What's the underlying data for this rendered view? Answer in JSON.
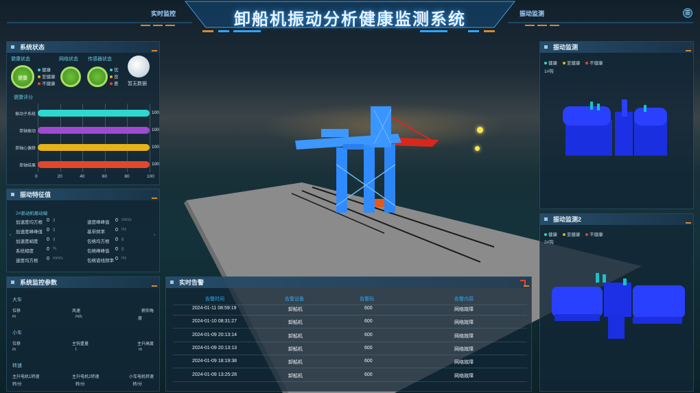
{
  "header": {
    "title": "卸船机振动分析健康监测系统",
    "nav_left": "实时监控",
    "nav_right": "振动监测",
    "menu_icon": "menu-icon"
  },
  "system_status": {
    "title": "系统状态",
    "health": {
      "label": "健康状态",
      "value": "健康",
      "legend": [
        "健康",
        "亚健康",
        "不健康"
      ]
    },
    "network": {
      "label": "网络状态",
      "legend": [
        "优",
        "良",
        "差"
      ]
    },
    "sensor": {
      "label": "传感器状态"
    },
    "no_data": "暂无数据",
    "score_label": "健康评分",
    "bars": [
      {
        "name": "振动子系统",
        "value": 100,
        "color": "#2ed8cf"
      },
      {
        "name": "单轴振动",
        "value": 100,
        "color": "#a04ad0"
      },
      {
        "name": "单轴心偏移",
        "value": 100,
        "color": "#e6b418"
      },
      {
        "name": "单轴结果",
        "value": 100,
        "color": "#e2472d"
      }
    ],
    "ticks": [
      "0",
      "20",
      "40",
      "60",
      "80",
      "100"
    ]
  },
  "vib_features": {
    "title": "振动特征值",
    "subtitle": "2#驱动机振动端",
    "left": [
      {
        "label": "加速度均方根",
        "value": "0",
        "unit": "g"
      },
      {
        "label": "加速度峰峰值",
        "value": "0",
        "unit": "g"
      },
      {
        "label": "加速度峭度",
        "value": "0",
        "unit": "g"
      },
      {
        "label": "系统相度",
        "value": "0",
        "unit": "%"
      },
      {
        "label": "速度均方根",
        "value": "0",
        "unit": "mm/s"
      }
    ],
    "right": [
      {
        "label": "速度峰峰值",
        "value": "0",
        "unit": "mm/s"
      },
      {
        "label": "基带频率",
        "value": "0",
        "unit": "Hz"
      },
      {
        "label": "包络均方根",
        "value": "0",
        "unit": "g"
      },
      {
        "label": "包络峰峰值",
        "value": "0",
        "unit": "g"
      },
      {
        "label": "包络谱线频率",
        "value": "0",
        "unit": "Hz"
      }
    ]
  },
  "sys_params": {
    "title": "系统监控参数",
    "sections": [
      {
        "name": "大车",
        "items": [
          {
            "label": "位移",
            "unit": "m"
          },
          {
            "label": "风速",
            "unit": "m/s"
          },
          {
            "label": "俯仰角",
            "unit": "度"
          }
        ]
      },
      {
        "name": "小车",
        "items": [
          {
            "label": "位移",
            "unit": "m"
          },
          {
            "label": "主钩重量",
            "unit": "t"
          },
          {
            "label": "主升高度",
            "unit": "m"
          }
        ]
      },
      {
        "name": "转速",
        "items": [
          {
            "label": "主升电机1转速",
            "unit": "转/分"
          },
          {
            "label": "主升电机2转速",
            "unit": "转/分"
          },
          {
            "label": "小车电机转速",
            "unit": "转/分"
          }
        ]
      }
    ]
  },
  "alerts": {
    "title": "实时告警",
    "columns": [
      "告警时间",
      "告警设备",
      "告警码",
      "告警内容"
    ],
    "rows": [
      [
        "2024-01-11 08:59:19",
        "卸船机",
        "600",
        "网络故障"
      ],
      [
        "2024-01-10 08:31:27",
        "卸船机",
        "600",
        "网络故障"
      ],
      [
        "2024-01-09 20:13:14",
        "卸船机",
        "600",
        "网络故障"
      ],
      [
        "2024-01-09 20:13:13",
        "卸船机",
        "600",
        "网络故障"
      ],
      [
        "2024-01-09 18:19:38",
        "卸船机",
        "600",
        "网络故障"
      ],
      [
        "2024-01-09 13:25:28",
        "卸船机",
        "600",
        "网络故障"
      ]
    ]
  },
  "vib_monitor1": {
    "title": "振动监测",
    "legend": [
      "健康",
      "亚健康",
      "不健康"
    ],
    "device": "1#钩"
  },
  "vib_monitor2": {
    "title": "振动监测2",
    "legend": [
      "健康",
      "亚健康",
      "不健康"
    ],
    "device": "2#钩"
  },
  "colors": {
    "accent": "#2fa8ff",
    "healthy": "#2ed8cf",
    "subhealthy": "#e6b418",
    "unhealthy": "#e2472d",
    "model_blue": "#1d63ff"
  }
}
